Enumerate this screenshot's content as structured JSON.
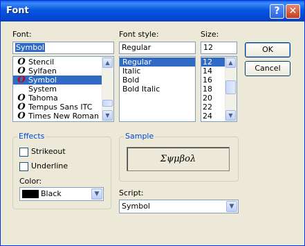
{
  "window": {
    "title": "Font",
    "help_glyph": "?",
    "close_glyph": "✕"
  },
  "font": {
    "label": "Font:",
    "value": "Symbol",
    "items": [
      {
        "icon": "O",
        "label": "Stencil"
      },
      {
        "icon": "O",
        "label": "Sylfaen"
      },
      {
        "icon": "O",
        "label": "Symbol",
        "selected": true
      },
      {
        "icon": "",
        "label": "System"
      },
      {
        "icon": "O",
        "label": "Tahoma"
      },
      {
        "icon": "O",
        "label": "Tempus Sans ITC"
      },
      {
        "icon": "O",
        "label": "Times New Roman"
      }
    ]
  },
  "style": {
    "label": "Font style:",
    "value": "Regular",
    "items": [
      "Regular",
      "Italic",
      "Bold",
      "Bold Italic"
    ]
  },
  "size": {
    "label": "Size:",
    "value": "12",
    "items": [
      "12",
      "14",
      "16",
      "18",
      "20",
      "22",
      "24"
    ]
  },
  "buttons": {
    "ok": "OK",
    "cancel": "Cancel"
  },
  "effects": {
    "label": "Effects",
    "strikeout": "Strikeout",
    "underline": "Underline",
    "color_label": "Color:",
    "color_value": "Black",
    "color_swatch": "#000000"
  },
  "sample": {
    "label": "Sample",
    "text": "Σψμβολ"
  },
  "script": {
    "label": "Script:",
    "value": "Symbol"
  },
  "scroll_glyphs": {
    "up": "▲",
    "down": "▼"
  }
}
